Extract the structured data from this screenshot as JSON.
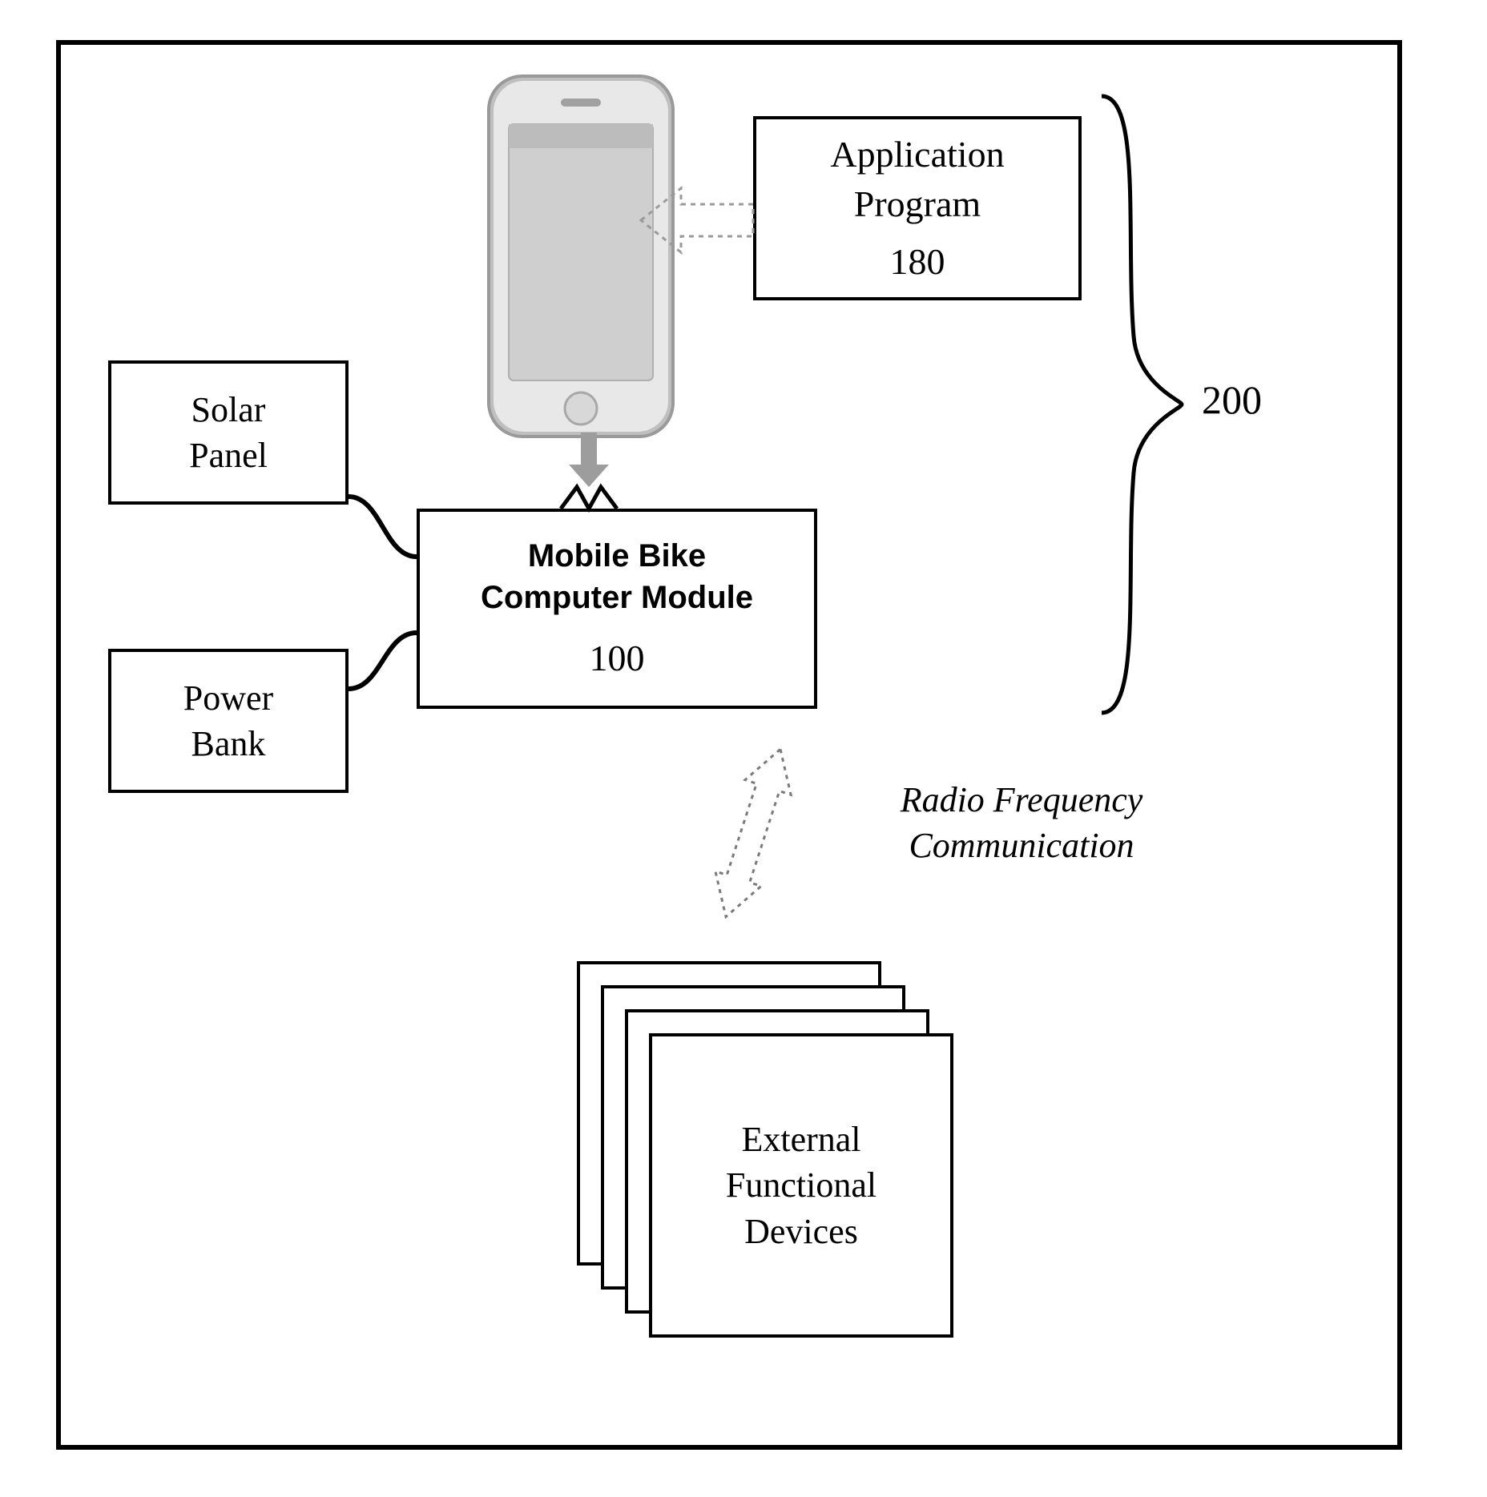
{
  "diagram": {
    "solar_panel": "Solar\nPanel",
    "power_bank": "Power\nBank",
    "application_program": "Application\nProgram",
    "application_program_ref": "180",
    "mobile_module_title": "Mobile Bike\nComputer Module",
    "mobile_module_ref": "100",
    "external_devices": "External\nFunctional\nDevices",
    "rf_comm": "Radio Frequency\nCommunication",
    "group_ref": "200"
  }
}
